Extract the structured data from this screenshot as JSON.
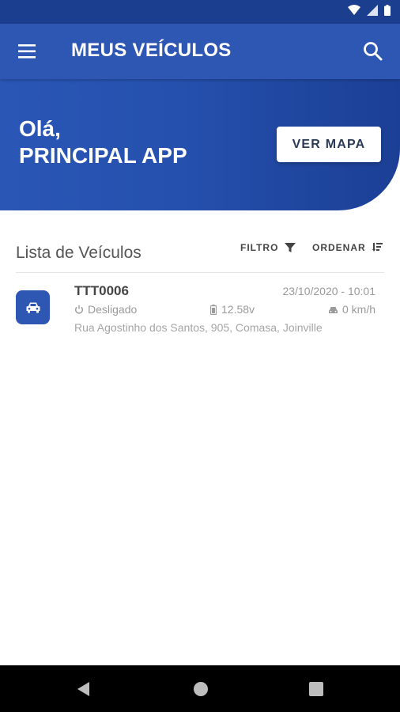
{
  "header": {
    "title": "MEUS VEÍCULOS",
    "menu_icon": "hamburger-menu-icon",
    "search_icon": "search-icon"
  },
  "hero": {
    "greeting_line1": "Olá,",
    "greeting_line2": "PRINCIPAL APP",
    "map_button": "VER MAPA"
  },
  "list": {
    "title": "Lista de Veículos",
    "filter_label": "FILTRO",
    "order_label": "ORDENAR",
    "vehicles": [
      {
        "plate": "TTT0006",
        "timestamp": "23/10/2020 - 10:01",
        "status": "Desligado",
        "voltage": "12.58v",
        "speed": "0 km/h",
        "address": "Rua Agostinho dos Santos, 905, Comasa, Joinville"
      }
    ]
  },
  "colors": {
    "primary": "#2e57b3",
    "status_bar": "#1b3f8e",
    "hero_gradient_end": "#1b3f95",
    "muted_text": "#9a9a9a"
  }
}
